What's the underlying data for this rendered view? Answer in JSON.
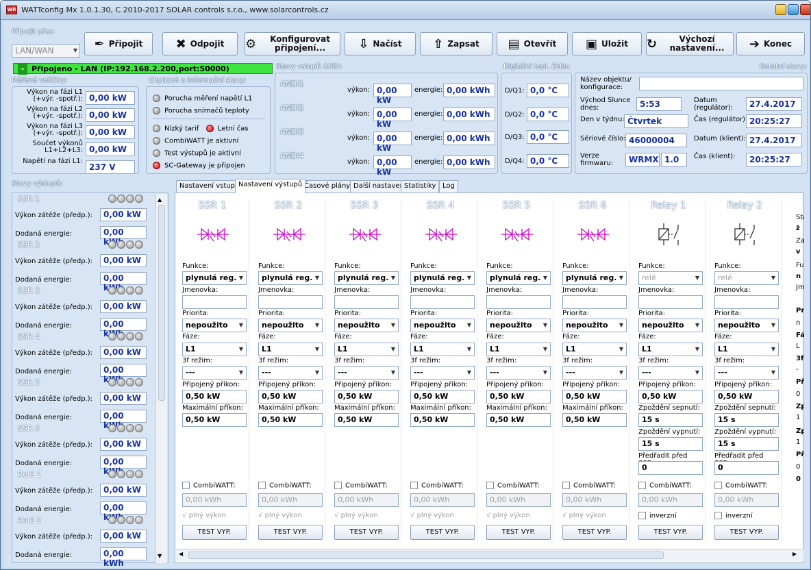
{
  "window": {
    "title": "WATTconfig Mx 1.0.1.30, C 2010-2017 SOLAR controls s.r.o., www.solarcontrols.cz",
    "app_icon": "WR"
  },
  "connect_via": {
    "label": "Připojit přes:",
    "value": "LAN/WAN"
  },
  "toolbar": [
    {
      "name": "connect-button",
      "label": "Připojit",
      "icon": "plug-icon",
      "glyph": "✒"
    },
    {
      "name": "disconnect-button",
      "label": "Odpojit",
      "icon": "unplug-icon",
      "glyph": "✖"
    },
    {
      "name": "configure-connection-button",
      "label": "Konfigurovat připojení...",
      "icon": "gear-icon",
      "glyph": "⚙"
    },
    {
      "name": "load-button",
      "label": "Načíst",
      "icon": "download-icon",
      "glyph": "⇩"
    },
    {
      "name": "write-button",
      "label": "Zapsat",
      "icon": "upload-icon",
      "glyph": "⇧"
    },
    {
      "name": "open-button",
      "label": "Otevřít",
      "icon": "folder-icon",
      "glyph": "▤"
    },
    {
      "name": "save-button",
      "label": "Uložit",
      "icon": "floppy-icon",
      "glyph": "▣"
    },
    {
      "name": "defaults-button",
      "label": "Výchozí nastavení...",
      "icon": "refresh-icon",
      "glyph": "↻"
    },
    {
      "name": "exit-button",
      "label": "Konec",
      "icon": "exit-door-icon",
      "glyph": "➔"
    }
  ],
  "status": {
    "dash": "-",
    "text": "Připojeno - LAN (IP:192.168.2.200,port:50000)"
  },
  "measured": {
    "title": "Měřené veličiny:",
    "rows": [
      {
        "label": "Výkon na fázi L1 (+výr. -spotř.):",
        "value": "0,00 kW"
      },
      {
        "label": "Výkon na fázi L2 (+výr. -spotř.):",
        "value": "0,00 kW"
      },
      {
        "label": "Výkon na fázi L3 (+výr. -spotř.):",
        "value": "0,00 kW"
      },
      {
        "label": "Součet výkonů L1+L2+L3:",
        "value": "0,00 kW"
      },
      {
        "label": "Napětí na fázi L1:",
        "value": "237 V"
      }
    ]
  },
  "errors": {
    "title": "Chybové a informační stavy:",
    "items": [
      {
        "label": "Porucha měření napětí L1",
        "red": false
      },
      {
        "label": "Porucha snímačů teploty",
        "red": false
      },
      {
        "label": "Nízký tarif",
        "red": false
      },
      {
        "label": "Letní čas",
        "red": true
      },
      {
        "label": "CombiWATT je aktivní",
        "red": false
      },
      {
        "label": "Test výstupů je aktivní",
        "red": false
      },
      {
        "label": "SC-Gateway je připojen",
        "red": true
      }
    ]
  },
  "andi": {
    "title": "Stavy vstupů ANDI:",
    "power_label": "výkon:",
    "energy_label": "energie:",
    "rows": [
      {
        "name": "ANDI1",
        "power": "0,00 kW",
        "energy": "0,00 kWh"
      },
      {
        "name": "ANDI2",
        "power": "0,00 kW",
        "energy": "0,00 kWh"
      },
      {
        "name": "ANDI3",
        "power": "0,00 kW",
        "energy": "0,00 kWh"
      },
      {
        "name": "ANDI4",
        "power": "0,00 kW",
        "energy": "0,00 kWh"
      }
    ]
  },
  "digital": {
    "title": "Digitální tepl. čidla:",
    "rows": [
      {
        "name": "D/Q1:",
        "value": "0,0 °C"
      },
      {
        "name": "D/Q2:",
        "value": "0,0 °C"
      },
      {
        "name": "D/Q3:",
        "value": "0,0 °C"
      },
      {
        "name": "D/Q4:",
        "value": "0,0 °C"
      }
    ]
  },
  "other": {
    "title": "Ostatní stavy:",
    "object_name_label": "Název objektu/ konfigurace:",
    "object_name_value": "",
    "sunrise_label": "Východ Slunce dnes:",
    "sunrise_value": "5:53",
    "date_reg_label": "Datum (regulátor):",
    "date_reg_value": "27.4.2017",
    "weekday_label": "Den v týdnu:",
    "weekday_value": "Čtvrtek",
    "time_reg_label": "Čas (regulátor):",
    "time_reg_value": "20:25:27",
    "serial_label": "Sériové číslo:",
    "serial_value": "46000004",
    "date_client_label": "Datum (klient):",
    "date_client_value": "27.4.2017",
    "fw_label": "Verze firmwaru:",
    "fw_model": "WRMX",
    "fw_version": "1.0",
    "time_client_label": "Čas (klient):",
    "time_client_value": "20:25:27"
  },
  "outputs_state": {
    "title": "Stavy výstupů:",
    "load_label": "Výkon zátěže (předp.):",
    "energy_label": "Dodaná energie:",
    "items": [
      {
        "name": "SSR 1",
        "load": "0,00 kW",
        "energy": "0,00 kWh"
      },
      {
        "name": "SSR 2",
        "load": "0,00 kW",
        "energy": "0,00 kWh"
      },
      {
        "name": "SSR 3",
        "load": "0,00 kW",
        "energy": "0,00 kWh"
      },
      {
        "name": "SSR 4",
        "load": "0,00 kW",
        "energy": "0,00 kWh"
      },
      {
        "name": "SSR 5",
        "load": "0,00 kW",
        "energy": "0,00 kWh"
      },
      {
        "name": "SSR 6",
        "load": "0,00 kW",
        "energy": "0,00 kWh"
      },
      {
        "name": "Relé 1",
        "load": "0,00 kW",
        "energy": "0,00 kWh"
      },
      {
        "name": "Relé 2",
        "load": "0,00 kW",
        "energy": "0,00 kWh"
      }
    ]
  },
  "tabs": [
    {
      "label": "Nastavení vstupů",
      "active": false
    },
    {
      "label": "Nastavení výstupů",
      "active": true
    },
    {
      "label": "Časové plány",
      "active": false
    },
    {
      "label": "Další nastavení",
      "active": false
    },
    {
      "label": "Statistiky",
      "active": false
    },
    {
      "label": "Log",
      "active": false
    }
  ],
  "labels": {
    "function": "Funkce:",
    "nominal": "Jmenovka:",
    "priority": "Priorita:",
    "phase": "Fáze:",
    "mode3f": "3f režim:",
    "connected": "Připojený příkon:",
    "maxpower": "Maximální příkon:",
    "delay_on": "Zpoždění sepnutí:",
    "delay_off": "Zpoždění vypnutí:",
    "preferred": "Předřadit před SSR:",
    "combiwatt": "CombiWATT:",
    "full_power": "plný výkon",
    "inverse": "inverzní",
    "test": "TEST VYP."
  },
  "ssr_columns": [
    {
      "name": "SSR 1",
      "function": "plynulá reg.",
      "nominal": "",
      "priority": "nepoužito",
      "phase": "L1",
      "mode3f": "---",
      "connected": "0,50 kW",
      "max": "0,50 kW",
      "combi_energy": "0,00 kWh"
    },
    {
      "name": "SSR 2",
      "function": "plynulá reg.",
      "nominal": "",
      "priority": "nepoužito",
      "phase": "L1",
      "mode3f": "---",
      "connected": "0,50 kW",
      "max": "0,50 kW",
      "combi_energy": "0,00 kWh"
    },
    {
      "name": "SSR 3",
      "function": "plynulá reg.",
      "nominal": "",
      "priority": "nepoužito",
      "phase": "L1",
      "mode3f": "---",
      "connected": "0,50 kW",
      "max": "0,50 kW",
      "combi_energy": "0,00 kWh"
    },
    {
      "name": "SSR 4",
      "function": "plynulá reg.",
      "nominal": "",
      "priority": "nepoužito",
      "phase": "L1",
      "mode3f": "---",
      "connected": "0,50 kW",
      "max": "0,50 kW",
      "combi_energy": "0,00 kWh"
    },
    {
      "name": "SSR 5",
      "function": "plynulá reg.",
      "nominal": "",
      "priority": "nepoužito",
      "phase": "L1",
      "mode3f": "---",
      "connected": "0,50 kW",
      "max": "0,50 kW",
      "combi_energy": "0,00 kWh"
    },
    {
      "name": "SSR 6",
      "function": "plynulá reg.",
      "nominal": "",
      "priority": "nepoužito",
      "phase": "L1",
      "mode3f": "---",
      "connected": "0,50 kW",
      "max": "0,50 kW",
      "combi_energy": "0,00 kWh"
    }
  ],
  "relay_columns": [
    {
      "name": "Relay 1",
      "function": "relé",
      "nominal": "",
      "priority": "nepoužito",
      "phase": "L1",
      "mode3f": "---",
      "connected": "0,50 kW",
      "delay_on": "15 s",
      "delay_off": "15 s",
      "preferred": "0",
      "combi_energy": "0,00 kWh"
    },
    {
      "name": "Relay 2",
      "function": "relé",
      "nominal": "",
      "priority": "nepoužito",
      "phase": "L1",
      "mode3f": "---",
      "connected": "0,50 kW",
      "delay_on": "15 s",
      "delay_off": "15 s",
      "preferred": "0",
      "combi_energy": "0,00 kWh"
    }
  ],
  "clipped_column": {
    "labels": [
      "Sta",
      "ž",
      "Za",
      "v",
      "Fu",
      "n",
      "Jm",
      "Pr",
      "n",
      "Fá",
      "L",
      "3f",
      "-",
      "Př",
      "0",
      "Zp",
      "1",
      "Zp",
      "1",
      "Př",
      "0",
      "0"
    ]
  },
  "colors": {
    "status_green": "#3ee53e",
    "value_blue": "#1733a0",
    "ssr_symbol": "#d000d0"
  }
}
